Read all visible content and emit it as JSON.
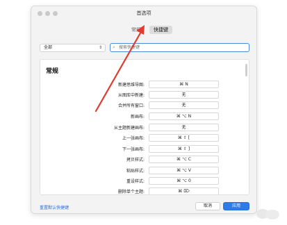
{
  "window": {
    "title": "首选项"
  },
  "tabs": [
    {
      "label": "常规",
      "active": false
    },
    {
      "label": "快捷键",
      "active": true
    }
  ],
  "filter": {
    "selected": "全部",
    "chevron_icon": "up-down-chevron-icon"
  },
  "search": {
    "placeholder": "搜索快捷键",
    "icon": "search-icon"
  },
  "section": {
    "heading": "常规"
  },
  "shortcuts": [
    {
      "label": "新建思维导图:",
      "key": "⌘ N"
    },
    {
      "label": "从图库中新建:",
      "key": "无"
    },
    {
      "label": "合并所有窗口:",
      "key": "无"
    },
    {
      "label": "新画布:",
      "key": "⌘ ⌥ N"
    },
    {
      "label": "从主题新建画布:",
      "key": "无"
    },
    {
      "label": "上一张画布:",
      "key": "⌘ ⇧ ["
    },
    {
      "label": "下一张画布:",
      "key": "⌘ ⇧ ]"
    },
    {
      "label": "拷贝样式:",
      "key": "⌘ ⌥ C"
    },
    {
      "label": "粘贴样式:",
      "key": "⌘ ⌥ V"
    },
    {
      "label": "重设样式:",
      "key": "⌘ ⌥ 0"
    },
    {
      "label": "删除单个主题:",
      "key": "⌘ ⌦"
    }
  ],
  "footer": {
    "reset_label": "重置默认快捷键",
    "cancel_label": "取消",
    "apply_label": "应用"
  },
  "colors": {
    "accent": "#2f7be8",
    "annotation_arrow": "#e23a2e"
  }
}
